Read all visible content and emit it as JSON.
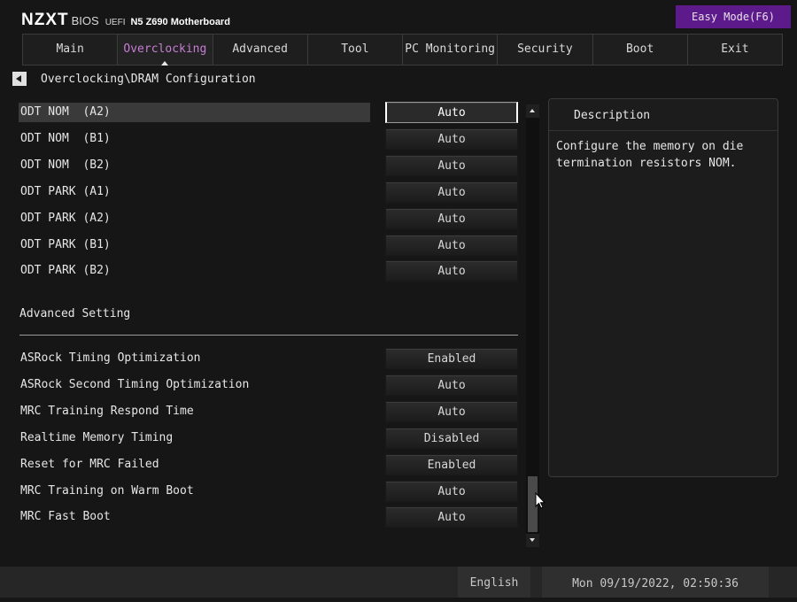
{
  "header": {
    "brand": "NZXT",
    "bios_label": "BIOS",
    "uefi_label": "UEFI",
    "model": "N5 Z690 Motherboard",
    "easy_mode_label": "Easy Mode(F6)"
  },
  "tabs": [
    {
      "label": "Main"
    },
    {
      "label": "Overclocking",
      "active": true
    },
    {
      "label": "Advanced"
    },
    {
      "label": "Tool"
    },
    {
      "label": "PC Monitoring"
    },
    {
      "label": "Security"
    },
    {
      "label": "Boot"
    },
    {
      "label": "Exit"
    }
  ],
  "breadcrumb": {
    "path": "Overclocking\\DRAM Configuration"
  },
  "settings_top": [
    {
      "label": "ODT NOM  (A2)",
      "value": "Auto",
      "selected": true
    },
    {
      "label": "ODT NOM  (B1)",
      "value": "Auto"
    },
    {
      "label": "ODT NOM  (B2)",
      "value": "Auto"
    },
    {
      "label": "ODT PARK (A1)",
      "value": "Auto"
    },
    {
      "label": "ODT PARK (A2)",
      "value": "Auto"
    },
    {
      "label": "ODT PARK (B1)",
      "value": "Auto"
    },
    {
      "label": "ODT PARK (B2)",
      "value": "Auto"
    }
  ],
  "section": {
    "title": "Advanced Setting"
  },
  "settings_bottom": [
    {
      "label": "ASRock Timing Optimization",
      "value": "Enabled"
    },
    {
      "label": "ASRock Second Timing Optimization",
      "value": "Auto"
    },
    {
      "label": "MRC Training Respond Time",
      "value": "Auto"
    },
    {
      "label": "Realtime Memory Timing",
      "value": "Disabled"
    },
    {
      "label": "Reset for MRC Failed",
      "value": "Enabled"
    },
    {
      "label": "MRC Training on Warm Boot",
      "value": "Auto"
    },
    {
      "label": "MRC Fast Boot",
      "value": "Auto"
    }
  ],
  "description": {
    "title": "Description",
    "text": "Configure the memory on die termination resistors NOM."
  },
  "footer": {
    "language": "English",
    "datetime": "Mon 09/19/2022, 02:50:36"
  },
  "colors": {
    "accent": "#5d1a8a",
    "active_tab_text": "#c77dd4",
    "background": "#161616"
  }
}
